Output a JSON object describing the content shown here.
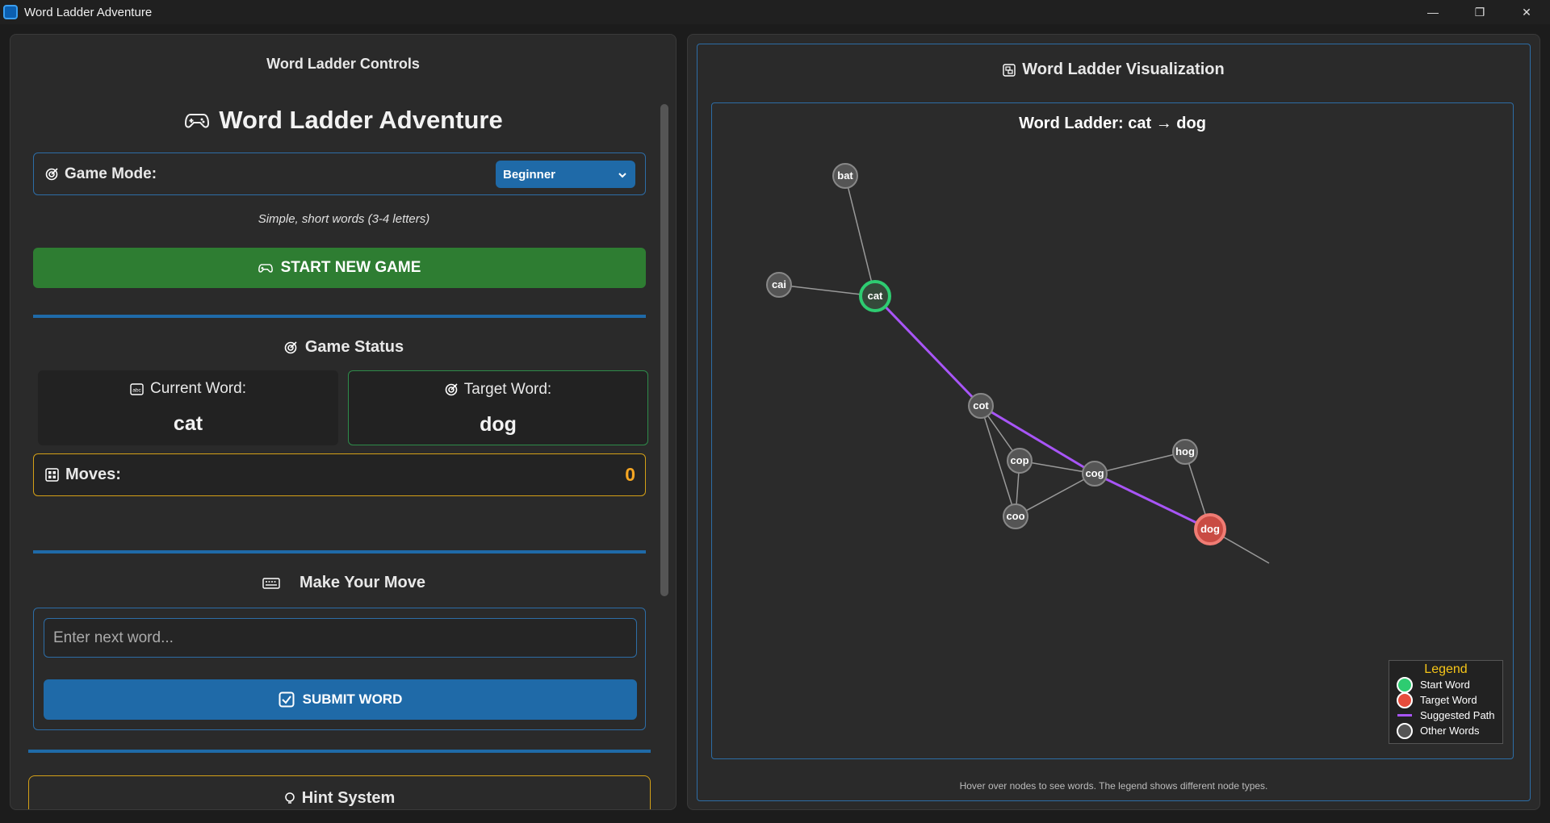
{
  "window": {
    "title": "Word Ladder Adventure",
    "minimize": "—",
    "maximize": "❐",
    "close": "✕"
  },
  "controls": {
    "panel_title": "Word Ladder Controls",
    "app_title": "Word Ladder Adventure",
    "game_mode_label": "Game Mode:",
    "game_mode_value": "Beginner",
    "mode_description": "Simple, short words (3-4 letters)",
    "start_button": "START NEW GAME",
    "status_title": "Game Status",
    "current_word_label": "Current Word:",
    "current_word": "cat",
    "target_word_label": "Target Word:",
    "target_word": "dog",
    "moves_label": "Moves:",
    "moves_value": "0",
    "move_title": "Make Your Move",
    "input_placeholder": "Enter next word...",
    "submit_button": "SUBMIT WORD",
    "hint_title": "Hint System"
  },
  "visualization": {
    "panel_title": "Word Ladder Visualization",
    "plot_title": "Word Ladder: cat → dog",
    "note": "Hover over nodes to see words. The legend shows different node types.",
    "legend": {
      "title": "Legend",
      "start": "Start Word",
      "target": "Target Word",
      "path": "Suggested Path",
      "other": "Other Words"
    },
    "colors": {
      "start": "#2ecc71",
      "target": "#e74c3c",
      "path": "#a855f7",
      "other": "#555555",
      "edge": "#9a9a9a"
    },
    "nodes": [
      {
        "word": "bat",
        "type": "other"
      },
      {
        "word": "cai",
        "type": "other"
      },
      {
        "word": "cat",
        "type": "start"
      },
      {
        "word": "cot",
        "type": "other"
      },
      {
        "word": "cop",
        "type": "other"
      },
      {
        "word": "cog",
        "type": "other"
      },
      {
        "word": "hog",
        "type": "other"
      },
      {
        "word": "coo",
        "type": "other"
      },
      {
        "word": "dog",
        "type": "target"
      }
    ],
    "edges": [
      [
        "bat",
        "cat"
      ],
      [
        "cai",
        "cat"
      ],
      [
        "cot",
        "cop"
      ],
      [
        "cot",
        "coo"
      ],
      [
        "cop",
        "coo"
      ],
      [
        "cop",
        "cog"
      ],
      [
        "coo",
        "cog"
      ],
      [
        "cog",
        "hog"
      ],
      [
        "hog",
        "dog"
      ]
    ],
    "path": [
      "cat",
      "cot",
      "cog",
      "dog"
    ]
  }
}
